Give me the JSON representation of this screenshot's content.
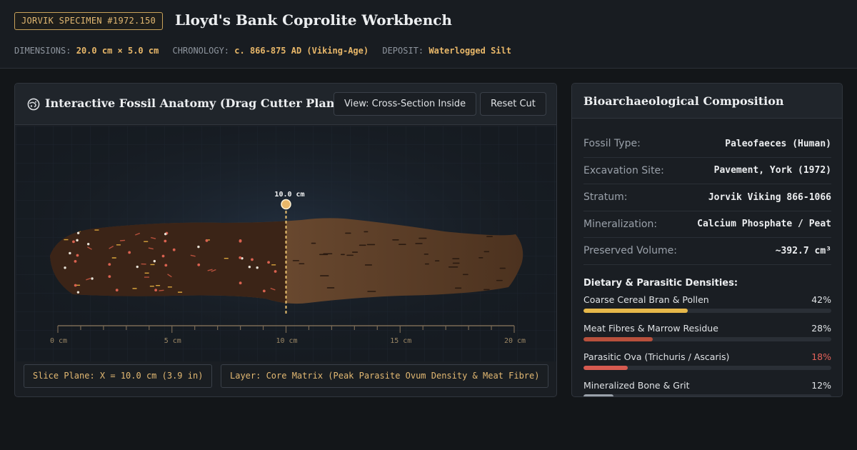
{
  "header": {
    "specimen_tag": "JORVIK SPECIMEN #1972.150",
    "title": "Lloyd's Bank Coprolite Workbench",
    "meta": [
      {
        "key": "DIMENSIONS:",
        "value": "20.0 cm × 5.0 cm"
      },
      {
        "key": "CHRONOLOGY:",
        "value": "c. 866-875 AD (Viking-Age)"
      },
      {
        "key": "DEPOSIT:",
        "value": "Waterlogged Silt"
      }
    ]
  },
  "anatomy_panel": {
    "title": "Interactive Fossil Anatomy (Drag Cutter Plane or Click)",
    "icon": "fossil-icon",
    "view_button": "View: Cross-Section Inside",
    "reset_button": "Reset Cut",
    "cutter": {
      "position_cm": 10.0,
      "label": "10.0 cm"
    },
    "ruler": {
      "min_cm": 0,
      "max_cm": 20,
      "labels": [
        "0 cm",
        "5 cm",
        "10 cm",
        "15 cm",
        "20 cm"
      ]
    },
    "slice_status": "Slice Plane: X = 10.0 cm (3.9 in)",
    "layer_status": "Layer: Core Matrix (Peak Parasite Ovum Density & Meat Fibre)"
  },
  "composition_panel": {
    "title": "Bioarchaeological Composition",
    "properties": [
      {
        "label": "Fossil Type:",
        "value": "Paleofaeces (Human)"
      },
      {
        "label": "Excavation Site:",
        "value": "Pavement, York (1972)"
      },
      {
        "label": "Stratum:",
        "value": "Jorvik Viking 866-1066"
      },
      {
        "label": "Mineralization:",
        "value": "Calcium Phosphate / Peat"
      },
      {
        "label": "Preserved Volume:",
        "value": "~392.7 cm³"
      }
    ],
    "densities_title": "Dietary & Parasitic Densities:",
    "densities": [
      {
        "label": "Coarse Cereal Bran & Pollen",
        "value": "42%",
        "fraction": 0.42,
        "color": "#e6b84a",
        "value_color": "#dfe2e5"
      },
      {
        "label": "Meat Fibres & Marrow Residue",
        "value": "28%",
        "fraction": 0.28,
        "color": "#b8503c",
        "value_color": "#dfe2e5"
      },
      {
        "label": "Parasitic Ova (Trichuris / Ascaris)",
        "value": "18%",
        "fraction": 0.18,
        "color": "#d65a50",
        "value_color": "#e5625a"
      },
      {
        "label": "Mineralized Bone & Grit",
        "value": "12%",
        "fraction": 0.12,
        "color": "#9aa1aa",
        "value_color": "#dfe2e5"
      }
    ]
  }
}
